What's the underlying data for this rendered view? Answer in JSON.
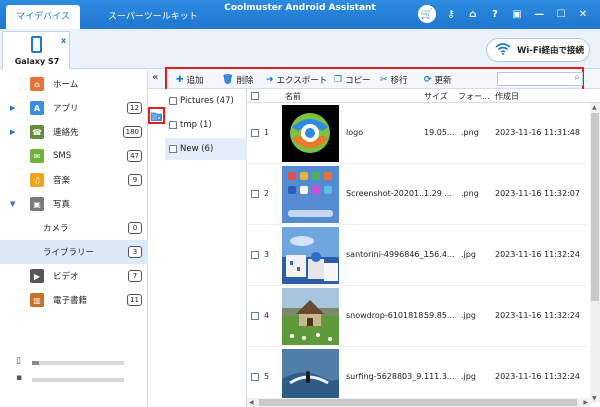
{
  "titlebar": {
    "tabs": [
      {
        "label": "マイデバイス"
      },
      {
        "label": "スーパーツールキット"
      }
    ],
    "app_title": "Coolmuster Android Assistant",
    "icons": [
      "cart-icon",
      "key-icon",
      "home-icon",
      "help-icon",
      "feedback-icon",
      "minimize-icon",
      "maximize-icon",
      "close-icon"
    ],
    "icon_glyphs": [
      "🛒",
      "⚷",
      "⌂",
      "?",
      "▣",
      "—",
      "☐",
      "✕"
    ]
  },
  "device": {
    "name": "Galaxy S7",
    "close": "x",
    "wifi_label": "Wi-Fi経由で接続"
  },
  "sidebar": {
    "items": [
      {
        "label": "ホーム",
        "badge": "",
        "color": "#e8733a",
        "glyph": "⌂",
        "arrow": ""
      },
      {
        "label": "アプリ",
        "badge": "12",
        "color": "#3a8fe0",
        "glyph": "A",
        "arrow": "▶"
      },
      {
        "label": "連絡先",
        "badge": "180",
        "color": "#5f8d3a",
        "glyph": "☎",
        "arrow": "▶"
      },
      {
        "label": "SMS",
        "badge": "47",
        "color": "#6cb33f",
        "glyph": "✉",
        "arrow": ""
      },
      {
        "label": "音楽",
        "badge": "9",
        "color": "#f2a51a",
        "glyph": "♫",
        "arrow": ""
      },
      {
        "label": "写真",
        "badge": "",
        "color": "#7a7a7a",
        "glyph": "▣",
        "arrow": "▼"
      },
      {
        "label": "カメラ",
        "badge": "0",
        "color": "",
        "glyph": "",
        "arrow": ""
      },
      {
        "label": "ライブラリー",
        "badge": "3",
        "color": "",
        "glyph": "",
        "arrow": ""
      },
      {
        "label": "ビデオ",
        "badge": "7",
        "color": "#555555",
        "glyph": "▶",
        "arrow": ""
      },
      {
        "label": "電子書籍",
        "badge": "11",
        "color": "#c9702a",
        "glyph": "▥",
        "arrow": ""
      }
    ],
    "storage": [
      {
        "fill": 0.08
      },
      {
        "fill": 0.0
      }
    ]
  },
  "toolbar": {
    "collapse": "«",
    "tools": [
      {
        "label": "追加",
        "glyph": "✚",
        "color": "#1f76cf"
      },
      {
        "label": "削除",
        "glyph": "🗑",
        "color": "#1f76cf"
      },
      {
        "label": "エクスポート",
        "glyph": "➜",
        "color": "#1f76cf"
      },
      {
        "label": "コピー",
        "glyph": "❐",
        "color": "#1f76cf"
      },
      {
        "label": "移行",
        "glyph": "✂",
        "color": "#1f76cf"
      },
      {
        "label": "更新",
        "glyph": "⟳",
        "color": "#1f76cf"
      }
    ],
    "search_placeholder": ""
  },
  "folders": [
    {
      "label": "Pictures (47)"
    },
    {
      "label": "tmp (1)"
    },
    {
      "label": "New (6)"
    }
  ],
  "table": {
    "headers": [
      "名前",
      "サイズ",
      "フォー...",
      "作成日"
    ],
    "rows": [
      {
        "num": "1",
        "name": "logo",
        "size": "19.05...",
        "format": ".png",
        "date": "2023-11-16 11:31:48"
      },
      {
        "num": "2",
        "name": "Screenshot-20201...",
        "size": "1.29 ...",
        "format": ".png",
        "date": "2023-11-16 11:32:07"
      },
      {
        "num": "3",
        "name": "santorini-4996846_...",
        "size": "156.4...",
        "format": ".jpg",
        "date": "2023-11-16 11:32:24"
      },
      {
        "num": "4",
        "name": "snowdrop-6101818...",
        "size": "59.85...",
        "format": ".jpg",
        "date": "2023-11-16 11:32:24"
      },
      {
        "num": "5",
        "name": "surfing-5628803_9...",
        "size": "111.3...",
        "format": ".jpg",
        "date": "2023-11-16 11:32:24"
      }
    ]
  },
  "colors": {
    "accent": "#1f76cf",
    "highlight": "#e02020"
  }
}
